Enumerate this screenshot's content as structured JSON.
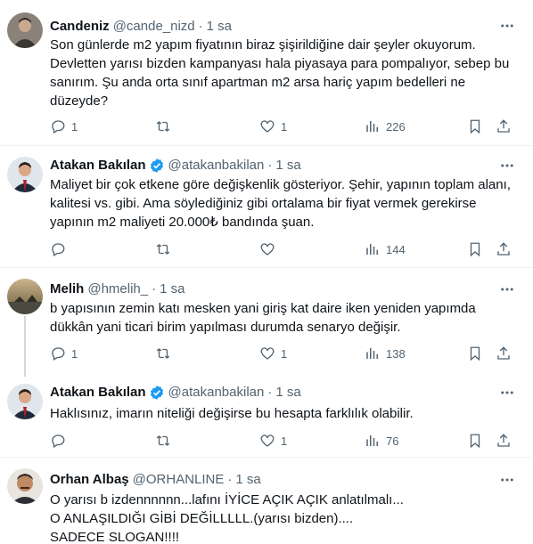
{
  "colors": {
    "text": "#0f1419",
    "muted": "#536471",
    "verified": "#1d9bf0",
    "divider": "#eff3f4"
  },
  "tweets": [
    {
      "name": "Candeniz",
      "handle": "@cande_nizd",
      "time": "1 sa",
      "verified": false,
      "text": "Son günlerde m2 yapım fiyatının biraz şişirildiğine dair şeyler okuyorum. Devletten yarısı bizden kampanyası hala piyasaya para pompalıyor, sebep bu sanırım. Şu anda orta sınıf apartman m2 arsa hariç yapım bedelleri ne düzeyde?",
      "replies": "1",
      "retweets": "",
      "likes": "1",
      "views": "226"
    },
    {
      "name": "Atakan Bakılan",
      "handle": "@atakanbakilan",
      "time": "1 sa",
      "verified": true,
      "text": "Maliyet bir çok etkene göre değişkenlik gösteriyor. Şehir, yapının toplam alanı, kalitesi vs. gibi. Ama söylediğiniz gibi ortalama bir fiyat vermek gerekirse yapının m2 maliyeti 20.000₺ bandında şuan.",
      "replies": "",
      "retweets": "",
      "likes": "",
      "views": "144"
    },
    {
      "name": "Melih",
      "handle": "@hmelih_",
      "time": "1 sa",
      "verified": false,
      "text": "b yapısının zemin katı mesken yani giriş kat daire iken yeniden yapımda dükkân yani ticari birim yapılması durumda senaryo değişir.",
      "replies": "1",
      "retweets": "",
      "likes": "1",
      "views": "138"
    },
    {
      "name": "Atakan Bakılan",
      "handle": "@atakanbakilan",
      "time": "1 sa",
      "verified": true,
      "text": "Haklısınız, imarın niteliği değişirse bu hesapta farklılık olabilir.",
      "replies": "",
      "retweets": "",
      "likes": "1",
      "views": "76"
    },
    {
      "name": "Orhan Albaş",
      "handle": "@ORHANLINE",
      "time": "1 sa",
      "verified": false,
      "text": "O yarısı b izdennnnnn...lafını İYİCE AÇIK AÇIK anlatılmalı...\nO ANLAŞILDIĞI GİBİ DEĞİLLLLL.(yarısı bizden)....\nSADECE SLOGAN!!!!"
    }
  ]
}
